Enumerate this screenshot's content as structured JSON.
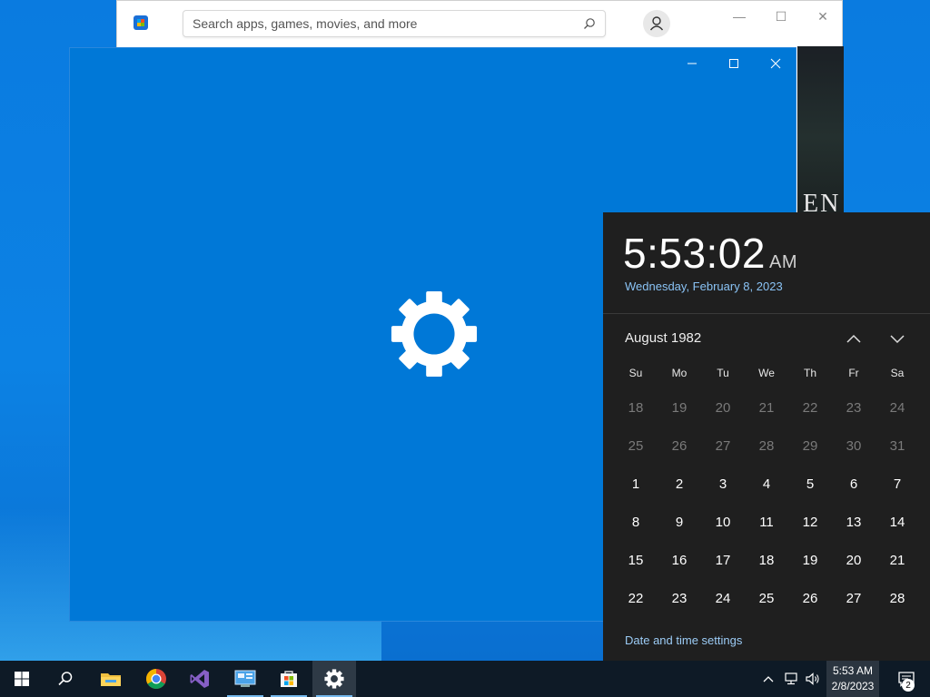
{
  "store": {
    "search_placeholder": "Search apps, games, movies, and more",
    "banner_text": "EN",
    "controls": {
      "minimize": "—",
      "maximize": "☐",
      "close": "✕"
    }
  },
  "settings_window": {
    "icon": "gear-icon",
    "accent_color": "#0078d7"
  },
  "clock_flyout": {
    "time": "5:53:02",
    "ampm": "AM",
    "date": "Wednesday, February 8, 2023",
    "month_label": "August 1982",
    "weekdays": [
      "Su",
      "Mo",
      "Tu",
      "We",
      "Th",
      "Fr",
      "Sa"
    ],
    "weeks": [
      [
        {
          "d": "18",
          "dim": true
        },
        {
          "d": "19",
          "dim": true
        },
        {
          "d": "20",
          "dim": true
        },
        {
          "d": "21",
          "dim": true
        },
        {
          "d": "22",
          "dim": true
        },
        {
          "d": "23",
          "dim": true
        },
        {
          "d": "24",
          "dim": true
        }
      ],
      [
        {
          "d": "25",
          "dim": true
        },
        {
          "d": "26",
          "dim": true
        },
        {
          "d": "27",
          "dim": true
        },
        {
          "d": "28",
          "dim": true
        },
        {
          "d": "29",
          "dim": true
        },
        {
          "d": "30",
          "dim": true
        },
        {
          "d": "31",
          "dim": true
        }
      ],
      [
        {
          "d": "1"
        },
        {
          "d": "2"
        },
        {
          "d": "3"
        },
        {
          "d": "4"
        },
        {
          "d": "5"
        },
        {
          "d": "6"
        },
        {
          "d": "7"
        }
      ],
      [
        {
          "d": "8"
        },
        {
          "d": "9"
        },
        {
          "d": "10"
        },
        {
          "d": "11"
        },
        {
          "d": "12"
        },
        {
          "d": "13"
        },
        {
          "d": "14"
        }
      ],
      [
        {
          "d": "15"
        },
        {
          "d": "16"
        },
        {
          "d": "17"
        },
        {
          "d": "18"
        },
        {
          "d": "19"
        },
        {
          "d": "20"
        },
        {
          "d": "21"
        }
      ],
      [
        {
          "d": "22"
        },
        {
          "d": "23"
        },
        {
          "d": "24"
        },
        {
          "d": "25"
        },
        {
          "d": "26"
        },
        {
          "d": "27"
        },
        {
          "d": "28"
        }
      ]
    ],
    "settings_link": "Date and time settings"
  },
  "taskbar": {
    "apps": [
      "start-icon",
      "search-icon",
      "file-explorer-icon",
      "chrome-icon",
      "visual-studio-icon",
      "control-panel-icon",
      "store-icon",
      "settings-icon"
    ],
    "active_app": "settings-icon",
    "clock_time": "5:53 AM",
    "clock_date": "2/8/2023",
    "notification_count": "2"
  }
}
